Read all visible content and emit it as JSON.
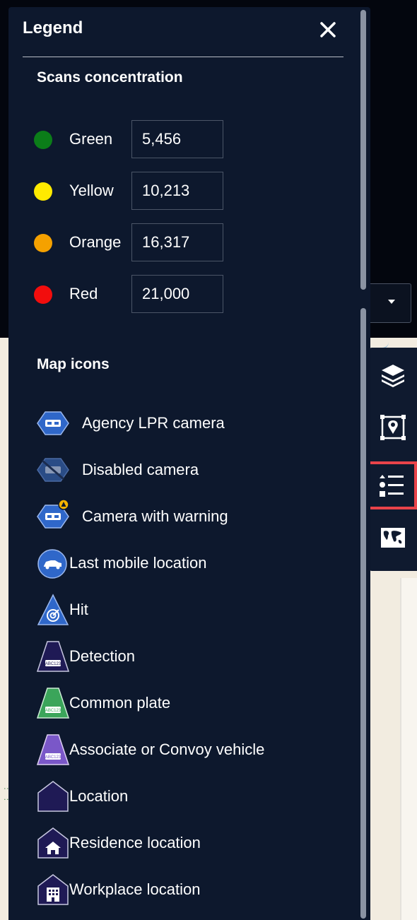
{
  "panel": {
    "title": "Legend",
    "close_icon": "close-icon"
  },
  "scans": {
    "title": "Scans concentration",
    "rows": [
      {
        "label": "Green",
        "value": "5,456",
        "color": "#0b7d19"
      },
      {
        "label": "Yellow",
        "value": "10,213",
        "color": "#ffea00"
      },
      {
        "label": "Orange",
        "value": "16,317",
        "color": "#f5a100"
      },
      {
        "label": "Red",
        "value": "21,000",
        "color": "#f20d0d"
      }
    ]
  },
  "map_icons": {
    "title": "Map icons",
    "items": [
      {
        "label": "Agency LPR camera",
        "icon": "agency-lpr-camera-icon"
      },
      {
        "label": "Disabled camera",
        "icon": "disabled-camera-icon"
      },
      {
        "label": "Camera with warning",
        "icon": "camera-warning-icon"
      },
      {
        "label": "Last mobile location",
        "icon": "mobile-location-icon"
      },
      {
        "label": "Hit",
        "icon": "hit-icon"
      },
      {
        "label": "Detection",
        "icon": "detection-icon"
      },
      {
        "label": "Common plate",
        "icon": "common-plate-icon"
      },
      {
        "label": "Associate or Convoy vehicle",
        "icon": "convoy-vehicle-icon"
      },
      {
        "label": "Location",
        "icon": "location-icon"
      },
      {
        "label": "Residence location",
        "icon": "residence-location-icon"
      },
      {
        "label": "Workplace location",
        "icon": "workplace-location-icon"
      }
    ]
  },
  "toolbar": {
    "items": [
      {
        "icon": "layers-icon",
        "active": false
      },
      {
        "icon": "map-pin-frame-icon",
        "active": false
      },
      {
        "icon": "legend-list-icon",
        "active": true
      },
      {
        "icon": "world-map-icon",
        "active": false
      }
    ]
  },
  "colors": {
    "panel_bg": "#0d182d",
    "camera_blue": "#2f67c9",
    "detection_purple": "#1f1a55",
    "common_plate_green": "#3ba55a",
    "convoy_purple": "#7a57c8",
    "highlight_red": "#e9434a"
  }
}
